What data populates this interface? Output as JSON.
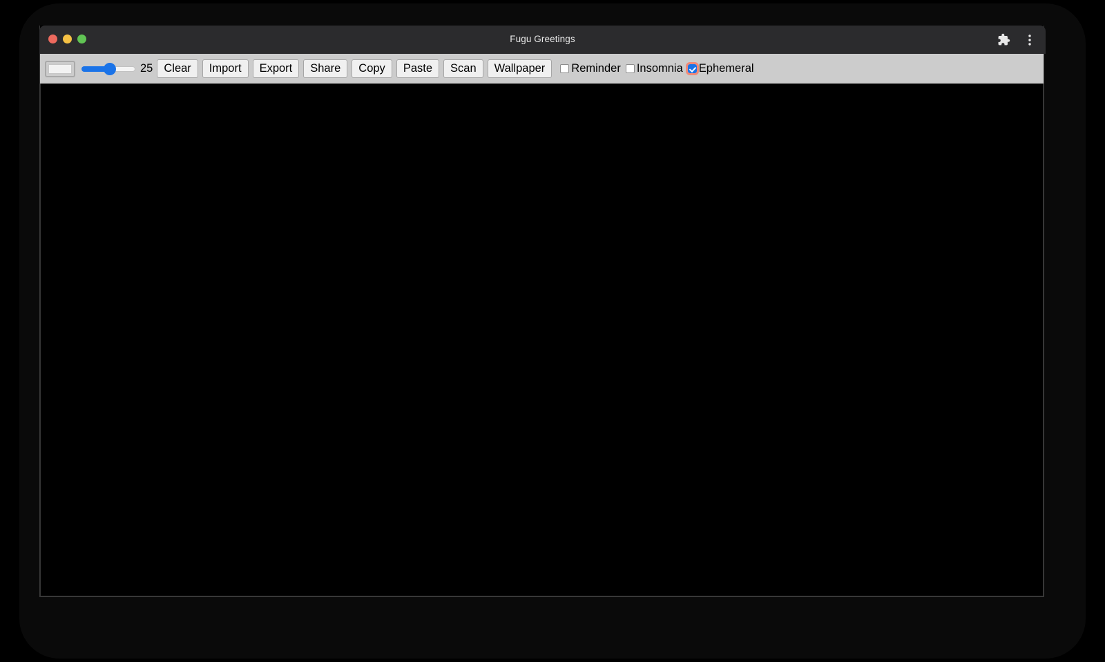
{
  "window": {
    "title": "Fugu Greetings",
    "traffic_lights": [
      {
        "name": "close",
        "color": "#ed6a5e"
      },
      {
        "name": "minimize",
        "color": "#f5c144"
      },
      {
        "name": "maximize",
        "color": "#61c454"
      }
    ],
    "titlebar_icons": [
      {
        "name": "extensions-icon",
        "label": "Extensions"
      },
      {
        "name": "browser-menu-icon",
        "label": "Customize and control"
      }
    ]
  },
  "toolbar": {
    "color_picker": {
      "name": "color-picker",
      "value": "#f2f2f2"
    },
    "size_slider": {
      "name": "line-width-slider",
      "value": 25,
      "min": 1,
      "max": 50,
      "display_value": "25"
    },
    "buttons": [
      {
        "name": "clear-button",
        "label": "Clear"
      },
      {
        "name": "import-button",
        "label": "Import"
      },
      {
        "name": "export-button",
        "label": "Export"
      },
      {
        "name": "share-button",
        "label": "Share"
      },
      {
        "name": "copy-button",
        "label": "Copy"
      },
      {
        "name": "paste-button",
        "label": "Paste"
      },
      {
        "name": "scan-button",
        "label": "Scan"
      },
      {
        "name": "wallpaper-button",
        "label": "Wallpaper"
      }
    ],
    "checkboxes": [
      {
        "name": "reminder-checkbox",
        "label": "Reminder",
        "checked": false,
        "focused": false
      },
      {
        "name": "insomnia-checkbox",
        "label": "Insomnia",
        "checked": false,
        "focused": false
      },
      {
        "name": "ephemeral-checkbox",
        "label": "Ephemeral",
        "checked": true,
        "focused": true
      }
    ]
  },
  "canvas": {
    "name": "drawing-canvas",
    "background": "#000000"
  },
  "colors": {
    "accent": "#1a73e8",
    "toolbar_bg": "#cccccc",
    "titlebar_bg": "#2b2b2d",
    "focus_ring": "#f08a78"
  }
}
